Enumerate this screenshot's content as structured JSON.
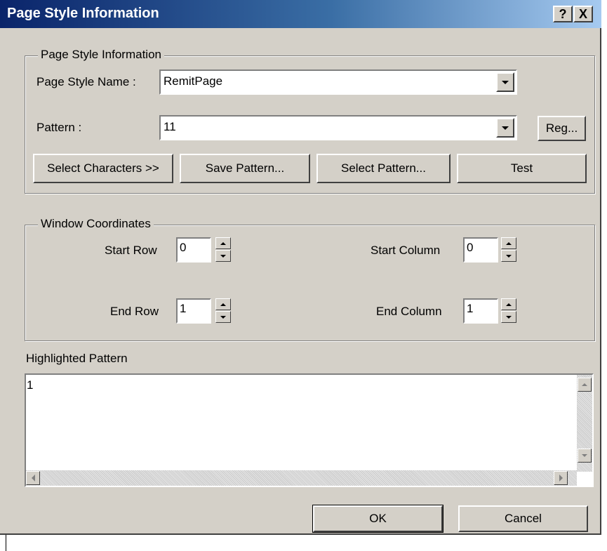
{
  "window": {
    "title": "Page Style Information",
    "help_label": "?",
    "close_label": "X"
  },
  "page_style_group": {
    "legend": "Page Style Information",
    "name_label": "Page Style Name :",
    "name_value": "RemitPage",
    "pattern_label": "Pattern :",
    "pattern_value": "11",
    "reg_label": "Reg...",
    "buttons": {
      "select_characters": "Select Characters >>",
      "save_pattern": "Save Pattern...",
      "select_pattern": "Select Pattern...",
      "test": "Test"
    }
  },
  "window_coordinates": {
    "legend": "Window Coordinates",
    "start_row_label": "Start Row",
    "start_row_value": "0",
    "start_column_label": "Start Column",
    "start_column_value": "0",
    "end_row_label": "End Row",
    "end_row_value": "1",
    "end_column_label": "End Column",
    "end_column_value": "1"
  },
  "highlighted": {
    "label": "Highlighted Pattern",
    "content": "1"
  },
  "footer": {
    "ok_label": "OK",
    "cancel_label": "Cancel"
  }
}
